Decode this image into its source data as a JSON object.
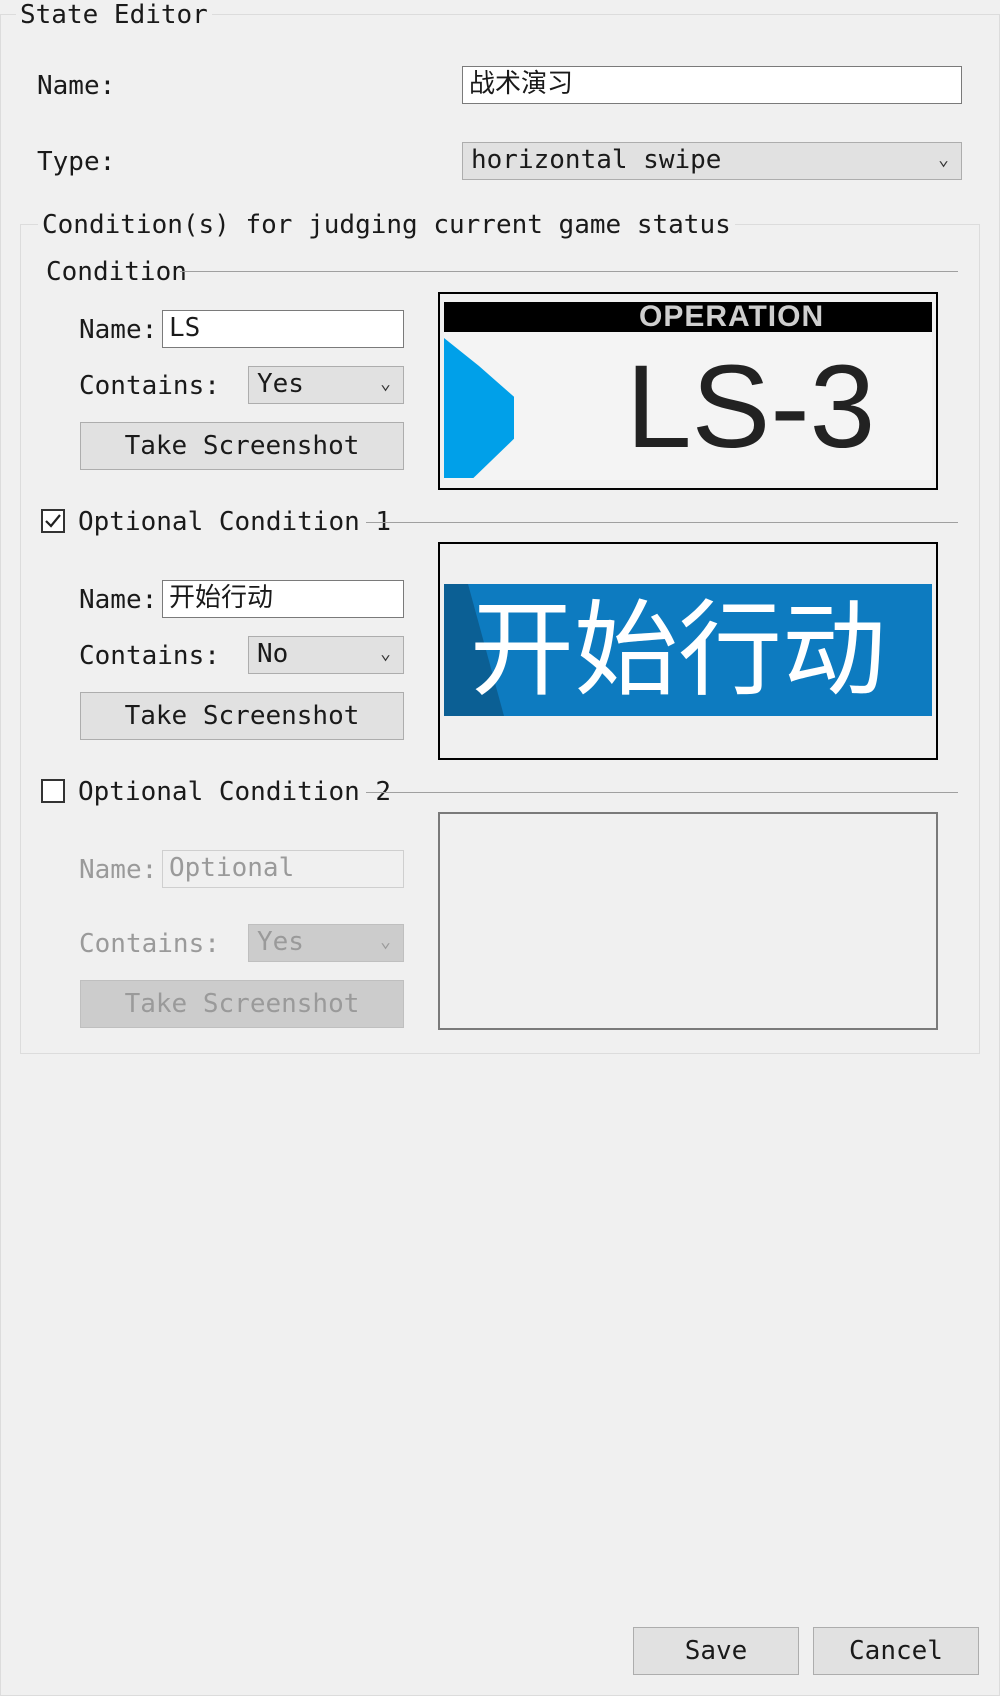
{
  "window": {
    "title": "State Editor"
  },
  "state": {
    "name_label": "Name:",
    "name_value": "战术演习",
    "type_label": "Type:",
    "type_value": "horizontal swipe"
  },
  "conditions_group": {
    "title": "Condition(s) for judging current game status"
  },
  "conditions": [
    {
      "header": "Condition",
      "name_label": "Name:",
      "name_value": "LS",
      "contains_label": "Contains:",
      "contains_value": "Yes",
      "screenshot_label": "Take Screenshot",
      "preview": {
        "top_text": "OPERATION",
        "main_text": "LS-3",
        "accent": "#00a0e9"
      }
    },
    {
      "header": "Optional Condition 1",
      "checked": true,
      "name_label": "Name:",
      "name_value": "开始行动",
      "contains_label": "Contains:",
      "contains_value": "No",
      "screenshot_label": "Take Screenshot",
      "preview": {
        "main_text": "开始行动",
        "accent": "#0d7bc0"
      }
    },
    {
      "header": "Optional Condition 2",
      "checked": false,
      "name_label": "Name:",
      "name_placeholder": "Optional",
      "contains_label": "Contains:",
      "contains_value": "Yes",
      "screenshot_label": "Take Screenshot"
    }
  ],
  "footer": {
    "save_label": "Save",
    "cancel_label": "Cancel"
  },
  "icons": {
    "chevron": "chevron-down-icon",
    "check": "checkmark-icon"
  }
}
